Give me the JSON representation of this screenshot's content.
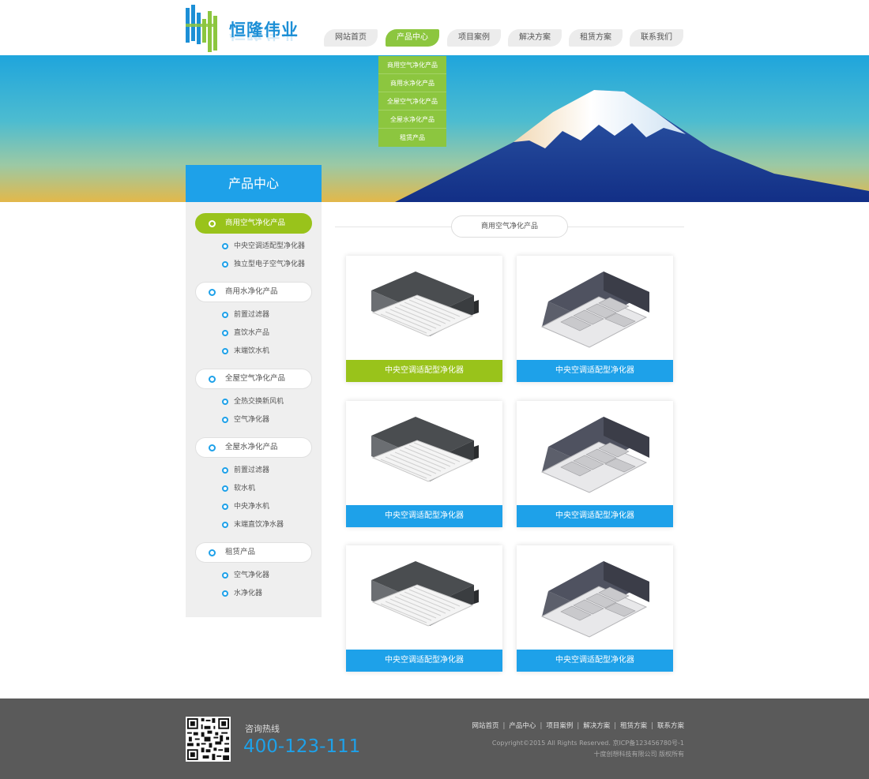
{
  "brand": {
    "name": "恒隆伟业",
    "blue": "#1c8fd6",
    "green": "#8cc63f"
  },
  "nav": {
    "items": [
      {
        "label": "网站首页",
        "active": false
      },
      {
        "label": "产品中心",
        "active": true
      },
      {
        "label": "项目案例",
        "active": false
      },
      {
        "label": "解决方案",
        "active": false
      },
      {
        "label": "租赁方案",
        "active": false
      },
      {
        "label": "联系我们",
        "active": false
      }
    ],
    "dropdown": [
      "商用空气净化产品",
      "商用水净化产品",
      "全屋空气净化产品",
      "全屋水净化产品",
      "租赁产品"
    ]
  },
  "sidebar": {
    "title": "产品中心",
    "categories": [
      {
        "label": "商用空气净化产品",
        "active": true,
        "subs": [
          "中央空调适配型净化器",
          "独立型电子空气净化器"
        ]
      },
      {
        "label": "商用水净化产品",
        "active": false,
        "subs": [
          "前置过滤器",
          "直饮水产品",
          "末端饮水机"
        ]
      },
      {
        "label": "全屋空气净化产品",
        "active": false,
        "subs": [
          "全热交换新风机",
          "空气净化器"
        ]
      },
      {
        "label": "全屋水净化产品",
        "active": false,
        "subs": [
          "前置过滤器",
          "软水机",
          "中央净水机",
          "末端直饮净水器"
        ]
      },
      {
        "label": "租赁产品",
        "active": false,
        "subs": [
          "空气净化器",
          "水净化器"
        ]
      }
    ]
  },
  "main": {
    "section_title": "商用空气净化产品",
    "products": [
      {
        "name": "中央空调适配型净化器",
        "icon": "ceiling-purifier-white",
        "highlighted": true
      },
      {
        "name": "中央空调适配型净化器",
        "icon": "ceiling-purifier-grille",
        "highlighted": false
      },
      {
        "name": "中央空调适配型净化器",
        "icon": "ceiling-purifier-white",
        "highlighted": false
      },
      {
        "name": "中央空调适配型净化器",
        "icon": "ceiling-purifier-grille",
        "highlighted": false
      },
      {
        "name": "中央空调适配型净化器",
        "icon": "ceiling-purifier-white",
        "highlighted": false
      },
      {
        "name": "中央空调适配型净化器",
        "icon": "ceiling-purifier-grille",
        "highlighted": false
      }
    ]
  },
  "footer": {
    "hotline_label": "咨询热线",
    "hotline_number": "400-123-111",
    "links": [
      "网站首页",
      "产品中心",
      "项目案例",
      "解决方案",
      "租赁方案",
      "联系方案"
    ],
    "copyright": "Copyright©2015 All Rights Reserved. 京ICP备123456780号-1",
    "company": "十度创想科技有限公司 版权所有"
  }
}
